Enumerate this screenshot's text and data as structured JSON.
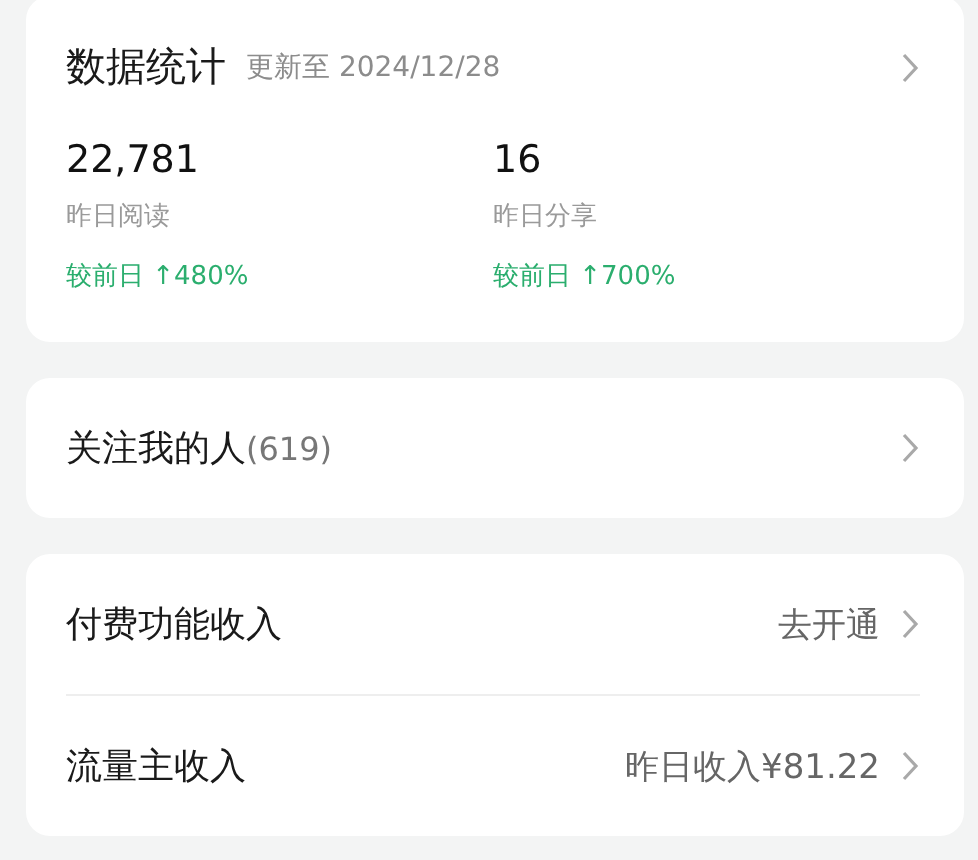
{
  "stats": {
    "title": "数据统计",
    "updated": "更新至 2024/12/28",
    "metrics": [
      {
        "value": "22,781",
        "label": "昨日阅读",
        "change": "较前日 ↑480%"
      },
      {
        "value": "16",
        "label": "昨日分享",
        "change": "较前日 ↑700%"
      }
    ]
  },
  "followers": {
    "label": "关注我的人",
    "count": "(619)"
  },
  "income": [
    {
      "label": "付费功能收入",
      "value": "去开通"
    },
    {
      "label": "流量主收入",
      "value": "昨日收入¥81.22"
    }
  ]
}
